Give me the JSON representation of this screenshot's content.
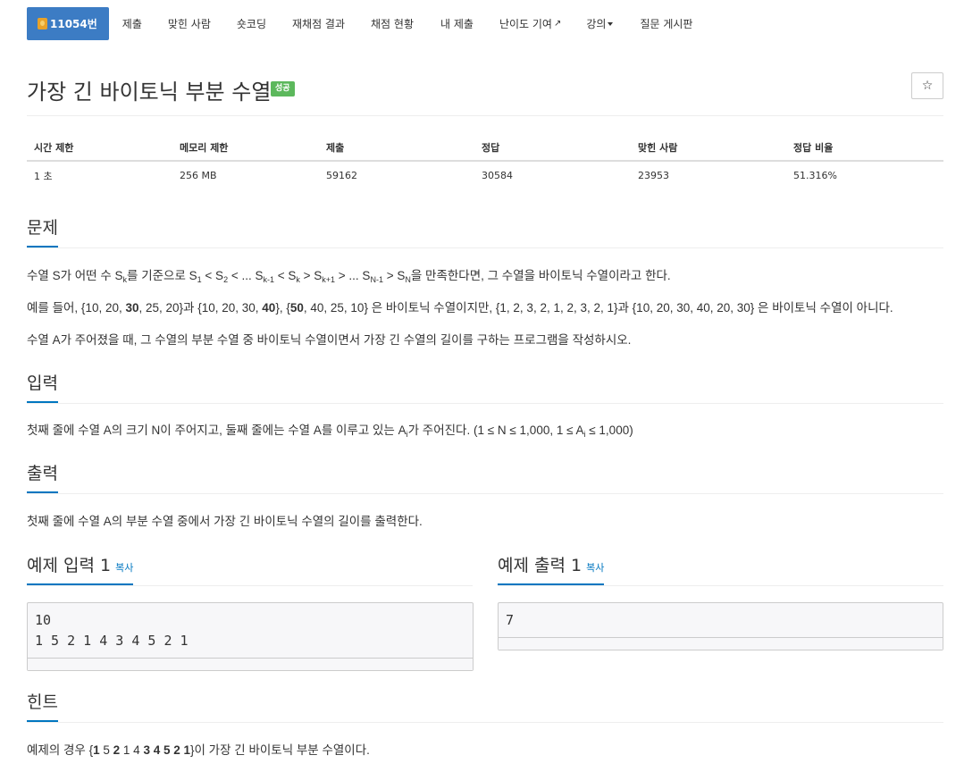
{
  "nav": {
    "problem_number": "11054번",
    "items": [
      "제출",
      "맞힌 사람",
      "숏코딩",
      "재채점 결과",
      "채점 현황",
      "내 제출",
      "난이도 기여",
      "강의",
      "질문 게시판"
    ]
  },
  "header": {
    "title": "가장 긴 바이토닉 부분 수열",
    "badge": "성공",
    "star": "☆"
  },
  "stats": {
    "headers": [
      "시간 제한",
      "메모리 제한",
      "제출",
      "정답",
      "맞힌 사람",
      "정답 비율"
    ],
    "values": [
      "1 초",
      "256 MB",
      "59162",
      "30584",
      "23953",
      "51.316%"
    ]
  },
  "sections": {
    "problem": "문제",
    "input": "입력",
    "output": "출력",
    "sample_input": "예제 입력 1",
    "sample_output": "예제 출력 1",
    "copy": "복사",
    "hint": "힌트"
  },
  "problem": {
    "line1": {
      "a": "수열 S가 어떤 수 S",
      "k1": "k",
      "b": "를 기준으로 S",
      "s1": "1",
      "c": " < S",
      "s2": "2",
      "d": " < ... S",
      "km1": "k-1",
      "e": " < S",
      "k2": "k",
      "f": " > S",
      "kp1": "k+1",
      "g": " > ... S",
      "nm1": "N-1",
      "h": " > S",
      "n": "N",
      "i": "을 만족한다면, 그 수열을 바이토닉 수열이라고 한다."
    },
    "line2": {
      "a": "예를 들어, {10, 20, ",
      "b1": "30",
      "c": ", 25, 20}과 {10, 20, 30, ",
      "b2": "40",
      "d": "}, {",
      "b3": "50",
      "e": ", 40, 25, 10} 은 바이토닉 수열이지만, {1, 2, 3, 2, 1, 2, 3, 2, 1}과 {10, 20, 30, 40, 20, 30} 은 바이토닉 수열이 아니다."
    },
    "line3": "수열 A가 주어졌을 때, 그 수열의 부분 수열 중 바이토닉 수열이면서 가장 긴 수열의 길이를 구하는 프로그램을 작성하시오."
  },
  "input": {
    "a": "첫째 줄에 수열 A의 크기 N이 주어지고, 둘째 줄에는 수열 A를 이루고 있는 A",
    "i1": "i",
    "b": "가 주어진다. (1 ≤ N ≤ 1,000, 1 ≤ A",
    "i2": "i",
    "c": " ≤ 1,000)"
  },
  "output": "첫째 줄에 수열 A의 부분 수열 중에서 가장 긴 바이토닉 수열의 길이를 출력한다.",
  "samples": {
    "input": "10\n1 5 2 1 4 3 4 5 2 1",
    "output": "7"
  },
  "hint": {
    "a": "예제의 경우 {",
    "b1": "1",
    "c": " 5 ",
    "b2": "2",
    "d": " 1 4 ",
    "b3": "3 4 5 2 1",
    "e": "}이 가장 긴 바이토닉 부분 수열이다."
  }
}
